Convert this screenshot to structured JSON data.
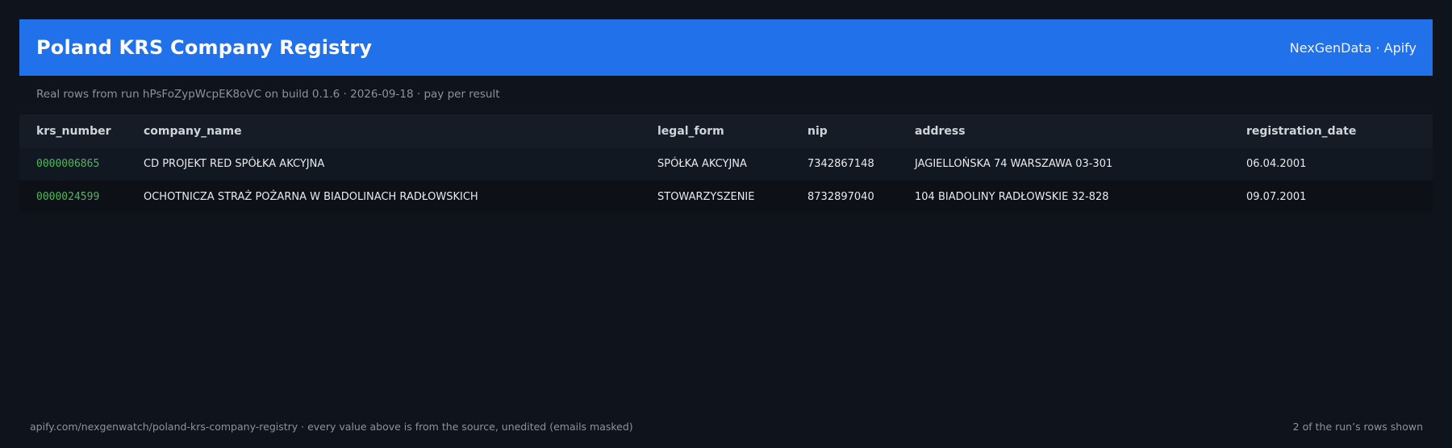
{
  "header": {
    "title": "Poland KRS Company Registry",
    "brand": "NexGenData · Apify"
  },
  "subtitle": "Real rows from run hPsFoZypWcpEK8oVC on build 0.1.6 · 2026-09-18 · pay per result",
  "table": {
    "columns": [
      "krs_number",
      "company_name",
      "legal_form",
      "nip",
      "address",
      "registration_date"
    ],
    "rows": [
      {
        "krs_number": "0000006865",
        "company_name": "CD PROJEKT RED SPÓŁKA AKCYJNA",
        "legal_form": "SPÓŁKA AKCYJNA",
        "nip": "7342867148",
        "address": "JAGIELLOŃSKA 74 WARSZAWA 03-301",
        "registration_date": "06.04.2001"
      },
      {
        "krs_number": "0000024599",
        "company_name": "OCHOTNICZA STRAŻ POŻARNA W BIADOLINACH RADŁOWSKICH",
        "legal_form": "STOWARZYSZENIE",
        "nip": "8732897040",
        "address": "104 BIADOLINY RADŁOWSKIE 32-828",
        "registration_date": "09.07.2001"
      }
    ]
  },
  "footer": {
    "left": "apify.com/nexgenwatch/poland-krs-company-registry  ·  every value above is from the source, unedited (emails masked)",
    "right": "2 of the run’s rows shown"
  },
  "colors": {
    "background": "#0f131b",
    "header": "#2171ea",
    "krs_accent": "#4fb85c"
  }
}
